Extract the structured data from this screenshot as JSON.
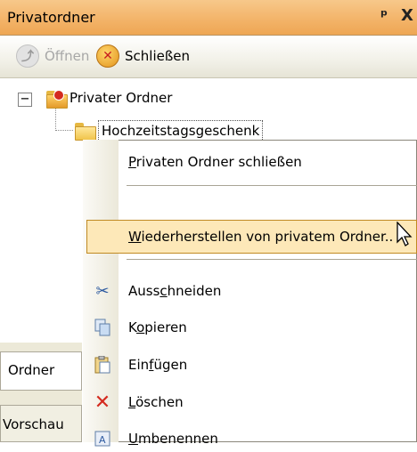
{
  "panel": {
    "title": "Privatordner",
    "pin_glyph": "1",
    "close_glyph": "X"
  },
  "toolbar": {
    "open_label": "Öffnen",
    "close_label": "Schließen",
    "open_icon": "open-folder-icon",
    "close_icon": "close-folder-icon"
  },
  "tree": {
    "root_label": "Privater Ordner",
    "child_label": "Hochzeitstagsgeschenk",
    "expander_glyph": "−"
  },
  "tabs": {
    "ordner": "Ordner",
    "vorschau": "Vorschau"
  },
  "context_menu": {
    "close_private_pre": "",
    "close_private_key": "P",
    "close_private_post": "rivaten Ordner schließen",
    "restore_pre": "",
    "restore_key": "W",
    "restore_post": "iederherstellen von privatem Ordner..",
    "cut_pre": "Auss",
    "cut_key": "c",
    "cut_post": "hneiden",
    "copy_pre": "K",
    "copy_key": "o",
    "copy_post": "pieren",
    "paste_pre": "Ein",
    "paste_key": "f",
    "paste_post": "ügen",
    "delete_pre": "",
    "delete_key": "L",
    "delete_post": "öschen",
    "rename_pre": "",
    "rename_key": "U",
    "rename_post": "mbenennen"
  },
  "colors": {
    "title_bar": "#f3b46a",
    "menu_highlight": "#fde8b8",
    "highlight_border": "#c08a23",
    "delete_icon": "#d42a1f"
  }
}
